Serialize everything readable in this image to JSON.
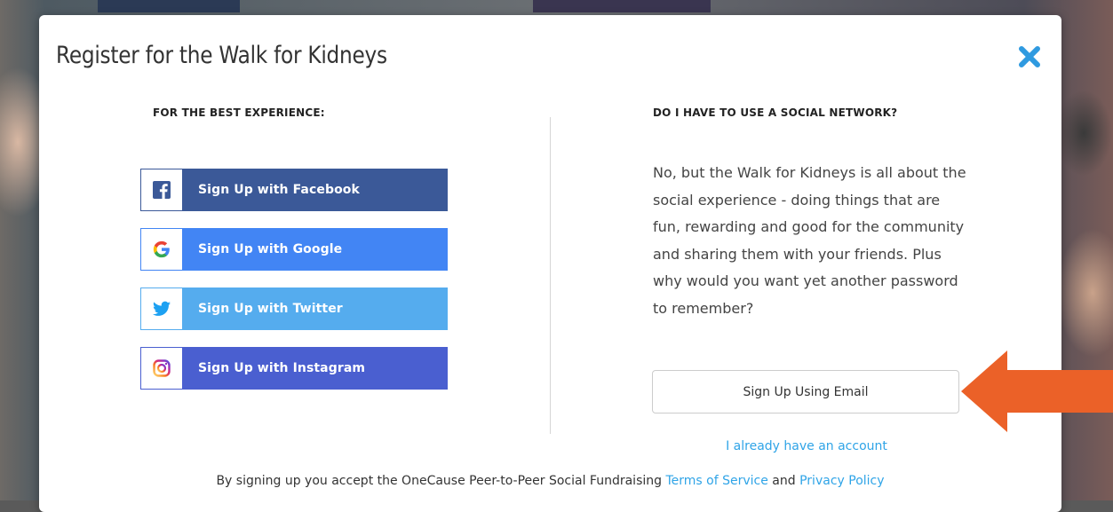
{
  "modal": {
    "title": "Register for the Walk for Kidneys",
    "close_icon": "close-x-icon",
    "close_color": "#2f9ae0"
  },
  "left_column": {
    "heading": "FOR THE BEST EXPERIENCE:",
    "buttons": [
      {
        "label": "Sign Up with Facebook",
        "icon": "facebook-icon",
        "color": "#3b5998"
      },
      {
        "label": "Sign Up with Google",
        "icon": "google-icon",
        "color": "#4285f4"
      },
      {
        "label": "Sign Up with Twitter",
        "icon": "twitter-icon",
        "color": "#55acee"
      },
      {
        "label": "Sign Up with Instagram",
        "icon": "instagram-icon",
        "color": "#4a5fd0"
      }
    ]
  },
  "right_column": {
    "heading": "DO I HAVE TO USE A SOCIAL NETWORK?",
    "paragraph": "No, but the Walk for Kidneys is all about the social experience - doing things that are fun, rewarding and good for the community and sharing them with your friends. Plus why would you want yet another password to remember?",
    "email_button": "Sign Up Using Email",
    "login_link": "I already have an account"
  },
  "footer": {
    "text_before": "By signing up you accept the OneCause Peer-to-Peer Social Fundraising ",
    "terms_link": "Terms of Service",
    "text_between": " and ",
    "privacy_link": "Privacy Policy",
    "link_color": "#2fa4e7"
  },
  "annotation": {
    "arrow_icon": "left-arrow-icon",
    "arrow_color": "#eb6128"
  }
}
